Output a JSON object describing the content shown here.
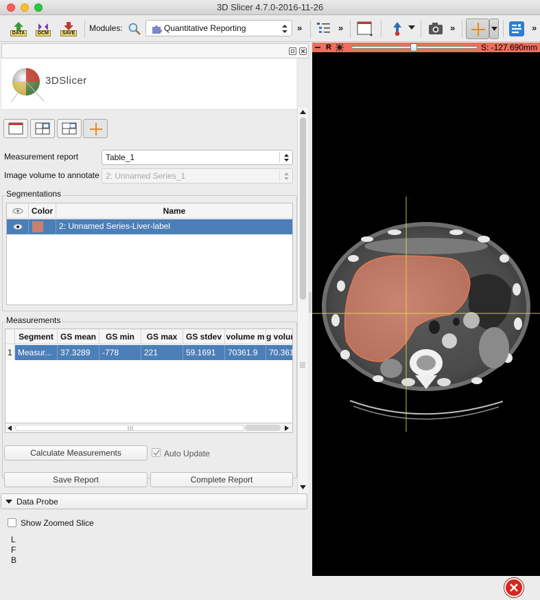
{
  "window": {
    "title": "3D Slicer 4.7.0-2016-11-26"
  },
  "toolbar": {
    "data_label": "DATA",
    "dcm_label": "DCM",
    "save_label": "SAVE",
    "modules_label": "Modules:",
    "module_selected": "Quantitative Reporting",
    "more": "»"
  },
  "logo": {
    "text": "3DSlicer"
  },
  "form": {
    "measurement_report_label": "Measurement report",
    "measurement_report_value": "Table_1",
    "image_volume_label": "Image volume to annotate",
    "image_volume_value": "2: Unnamed Series_1"
  },
  "segmentations": {
    "title": "Segmentations",
    "headers": [
      "Color",
      "Name"
    ],
    "rows": [
      {
        "color": "#c9806c",
        "name": "2: Unnamed Series-Liver-label"
      }
    ]
  },
  "measurements": {
    "title": "Measurements",
    "headers": [
      "Segment",
      "GS mean",
      "GS min",
      "GS max",
      "GS stdev",
      "volume m",
      "ɡ volur"
    ],
    "rows": [
      {
        "index": "1",
        "cells": [
          "Measur...",
          "37.3289",
          "-778",
          "221",
          "59.1691",
          "70361.9",
          "70.361"
        ]
      }
    ]
  },
  "buttons": {
    "calculate": "Calculate Measurements",
    "auto_update": "Auto Update",
    "auto_update_checked": true,
    "save_report": "Save Report",
    "complete_report": "Complete Report"
  },
  "data_probe": {
    "title": "Data Probe",
    "show_zoomed": "Show Zoomed Slice",
    "show_zoomed_checked": false,
    "lines": [
      "L",
      "F",
      "B"
    ]
  },
  "slice_view": {
    "label": "R",
    "offset": "S: -127.690mm",
    "slider_fraction": 0.49,
    "bar_color": "#e8705c",
    "crosshair_color": "#e6e640"
  }
}
